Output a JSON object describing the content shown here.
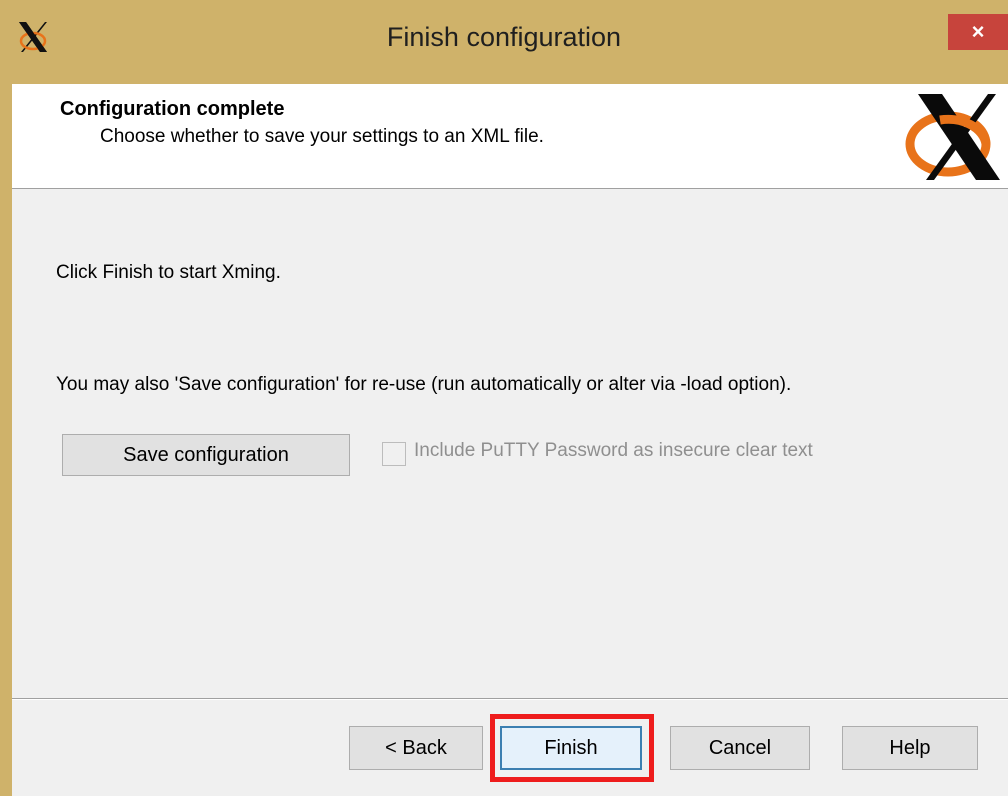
{
  "window": {
    "title": "Finish configuration",
    "close_glyph": "×",
    "app_icon": "xming-x-icon",
    "titlebar_color": "#cfb26a",
    "close_color": "#c7443c"
  },
  "header": {
    "title": "Configuration complete",
    "subtitle": "Choose whether to save your settings to an XML file.",
    "logo": "xming-logo"
  },
  "content": {
    "line1": "Click Finish to start Xming.",
    "line2": "You may also 'Save configuration' for re-use (run automatically or alter via -load option).",
    "save_button_label": "Save configuration",
    "checkbox_label": "Include PuTTY Password as insecure clear text",
    "checkbox_checked": false,
    "checkbox_enabled": false
  },
  "footer": {
    "back_label": "< Back",
    "finish_label": "Finish",
    "cancel_label": "Cancel",
    "help_label": "Help",
    "highlight_color": "#ee1c1c"
  }
}
